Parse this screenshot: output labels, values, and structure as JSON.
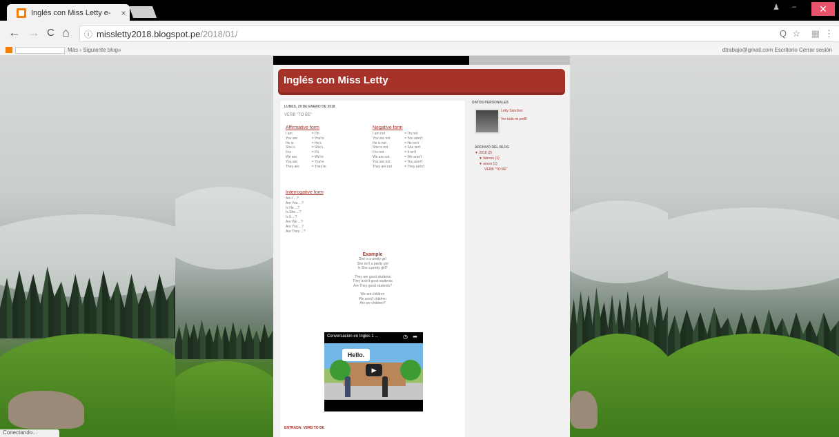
{
  "browser": {
    "tab_title": "Inglés con Miss Letty e-",
    "close_tab": "×",
    "url_host": "missletty2018.blogspot.pe",
    "url_path": "/2018/01/",
    "back": "←",
    "forward": "→",
    "reload": "C",
    "home": "⌂",
    "info": "ⓘ",
    "zoom": "Q",
    "star": "☆",
    "menu": "⋮",
    "window_close": "✕"
  },
  "blogger_bar": {
    "more": "Más ›  Siguiente blog»",
    "right": "dtrabajo@gmail.com  Escritorio  Cerrar sesión"
  },
  "blog": {
    "title": "Inglés con Miss Letty",
    "date_header": "LUNES, 29 DE ENERO DE 2018",
    "post_title": "VERB \"TO BE\"",
    "affirmative": {
      "heading": "Affirmative form",
      "left": [
        "I am",
        "You are",
        "He is",
        "She is",
        "It is",
        "We are",
        "You are",
        "They are"
      ],
      "right": [
        "= I'm",
        "= You're",
        "= He's",
        "= She's",
        "= It's",
        "= We're",
        "= You're",
        "= They're"
      ]
    },
    "negative": {
      "heading": "Negative form",
      "left": [
        "I am not",
        "You are not",
        "He is not",
        "She is not",
        "It is not",
        "We are not",
        "You are not",
        "They are not"
      ],
      "right": [
        "= I'm not",
        "= You aren't",
        "= He isn't",
        "= She isn't",
        "= It isn't",
        "= We aren't",
        "= You aren't",
        "= They aren't"
      ]
    },
    "interrogative": {
      "heading": "Interrogative form",
      "lines": [
        "Am I ...?",
        "Are You ...?",
        "Is He ...?",
        "Is She ...?",
        "Is It ...?",
        "Are We ...?",
        "Are You ...?",
        "Are They ...?"
      ]
    },
    "example": {
      "heading": "Example",
      "lines": [
        "She is a pretty girl",
        "She isn't a pretty girl",
        "Is She a pretty girl?",
        "",
        "They are good students",
        "They aren't good students",
        "Are They good students?",
        "",
        "We are children",
        "We aren't children",
        "Are we children?"
      ]
    },
    "video": {
      "title": "Conversacion en Ingles 1 ...",
      "speech": "Hello.",
      "play": "▶"
    },
    "footer_link": "ENTRADA: VERB TO BE"
  },
  "sidebar": {
    "profile_heading": "DATOS PERSONALES",
    "name": "Letty Sánchez",
    "view_profile": "Ver todo mi perfil",
    "archive_heading": "ARCHIVO DEL BLOG",
    "archive": [
      "▼ 2018 (2)",
      "▼ febrero (1)",
      "▼ enero (1)",
      "VERB \"TO BE\""
    ]
  },
  "status": "Conectando..."
}
